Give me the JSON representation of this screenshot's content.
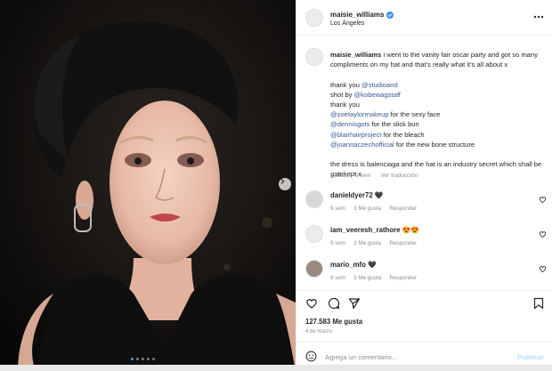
{
  "post": {
    "username": "maisie_williams",
    "location": "Los Ángeles",
    "carousel_dots": 5,
    "active_dot": 1
  },
  "caption": {
    "username": "maisie_williams",
    "line1": " i went to the vanity fair oscar party and got so many compliments on my hat and that's really what it's all about x",
    "thanks_label": "thank you ",
    "thanks_handle": "@studioand",
    "shot_label": "shot by ",
    "shot_handle": "@kobewagstaff",
    "thanks2": "thank you",
    "credits": [
      {
        "handle": "@zoetaylormakeup",
        "text": " for the sexy face"
      },
      {
        "handle": "@dennisgots",
        "text": " for the slick bun"
      },
      {
        "handle": "@blairhairproject",
        "text": " for the bleach"
      },
      {
        "handle": "@joannaczechofficial",
        "text": " for the new bone structure"
      }
    ],
    "closing": "the dress is balenciaga and the hat is an industry secret which shall be gatekept x",
    "edited": "Editado · 5 sem",
    "translate": "Ver traducción"
  },
  "comments": [
    {
      "username": "danieldyer72",
      "text": " 🖤",
      "time": "9 sem",
      "likes": "3 Me gusta",
      "reply": "Responder"
    },
    {
      "username": "iam_veeresh_rathore",
      "text": " 😍😍",
      "time": "9 sem",
      "likes": "3 Me gusta",
      "reply": "Responder"
    },
    {
      "username": "mario_mfo",
      "text": " 🖤",
      "time": "9 sem",
      "likes": "3 Me gusta",
      "reply": "Responder"
    }
  ],
  "footer": {
    "likes": "127.583 Me gusta",
    "date": "4 de marzo",
    "comment_placeholder": "Agrega un comentario...",
    "post_label": "Publicar"
  },
  "colors": {
    "link": "#3b5998",
    "verified": "#3897f0",
    "post_disabled": "#b2dffc"
  }
}
